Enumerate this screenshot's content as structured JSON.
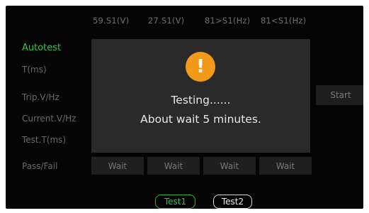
{
  "columns": [
    "59.S1(V)",
    "27.S1(V)",
    "81>S1(Hz)",
    "81<S1(Hz)"
  ],
  "labels": {
    "autotest": "Autotest",
    "t_ms": "T(ms)",
    "trip": "Trip.V/Hz",
    "current": "Current.V/Hz",
    "test_t": "Test.T(ms)",
    "pass_fail": "Pass/Fail"
  },
  "wait_cells": [
    "Wait",
    "Wait",
    "Wait",
    "Wait"
  ],
  "start_label": "Start",
  "modal": {
    "icon": "warning-icon",
    "line1": "Testing......",
    "line2": "About wait 5 minutes."
  },
  "tabs": {
    "test1": "Test1",
    "test2": "Test2"
  },
  "colors": {
    "active": "#35c24a",
    "warning": "#f29a1a",
    "background": "#050505"
  }
}
